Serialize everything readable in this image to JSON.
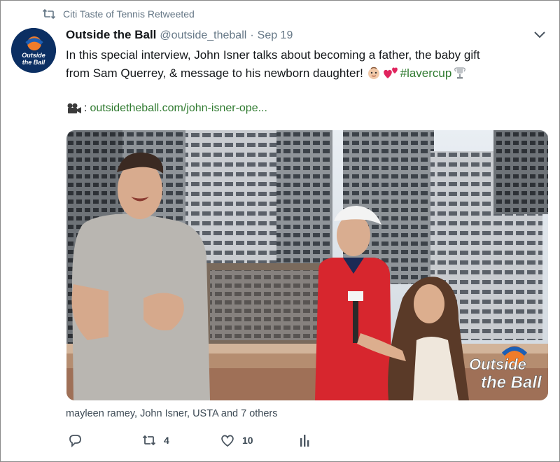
{
  "retweet": {
    "text": "Citi Taste of Tennis Retweeted"
  },
  "tweet": {
    "display_name": "Outside the Ball",
    "handle": "@outside_theball",
    "separator": "·",
    "date": "Sep 19",
    "text_line1": "In this special interview, John Isner talks about becoming a father, the baby gift",
    "text_line2_prefix": "from Sam Querrey, & message to his newborn daughter! ",
    "hashtag": "#lavercup",
    "link_colon": ":",
    "link_url": "outsidetheball.com/john-isner-ope..."
  },
  "avatar": {
    "logo_line1": "Outside",
    "logo_line2": "the Ball"
  },
  "media": {
    "watermark_line1": "Outside",
    "watermark_line2": "the Ball"
  },
  "likers": "mayleen ramey, John Isner, USTA and 7 others",
  "actions": {
    "reply": {
      "icon": "reply-icon",
      "count": ""
    },
    "retweet": {
      "icon": "retweet-icon",
      "count": "4"
    },
    "like": {
      "icon": "heart-icon",
      "count": "10"
    },
    "analytics": {
      "icon": "analytics-icon",
      "count": ""
    }
  },
  "colors": {
    "hashtag": "#2f7a2f",
    "secondary": "#657786",
    "avatar_bg": "#0b2f63",
    "logo_orange": "#f07c2a"
  },
  "emoji": {
    "baby": "baby-icon",
    "heart": "hearts-icon",
    "trophy": "trophy-icon",
    "camera": "movie-camera-icon"
  }
}
